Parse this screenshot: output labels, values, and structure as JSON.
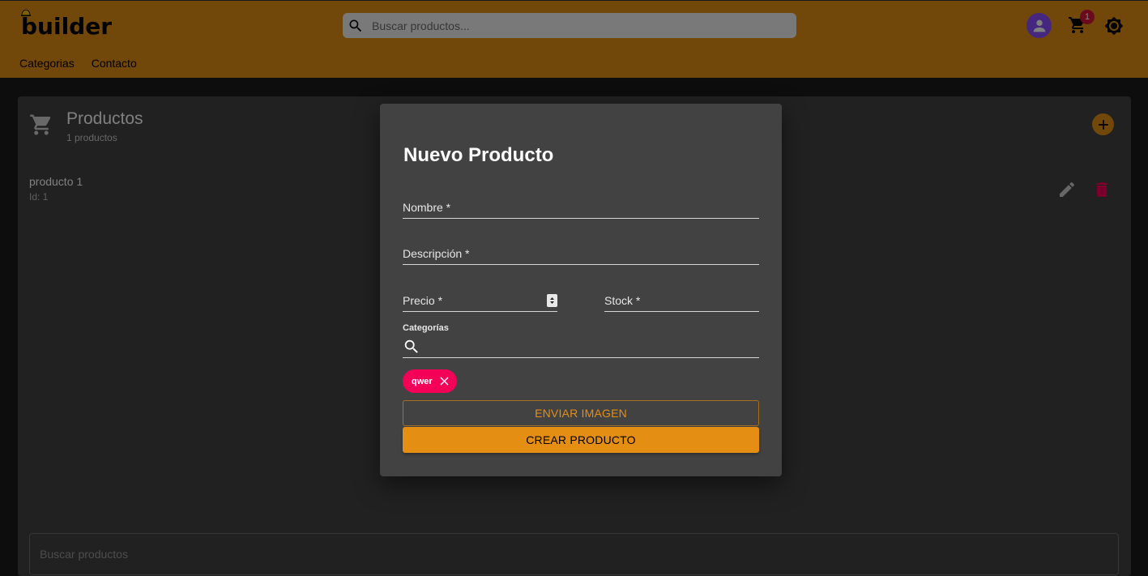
{
  "brand": {
    "name": "builder"
  },
  "header": {
    "search_placeholder": "Buscar productos...",
    "cart_count": "1",
    "nav": [
      "Categorias",
      "Contacto"
    ]
  },
  "colors": {
    "accent": "#e58e14",
    "danger": "#f50057",
    "avatar": "#8a4fff"
  },
  "panel": {
    "title": "Productos",
    "subtitle": "1 productos",
    "items": [
      {
        "name": "producto 1",
        "id_text": "Id: 1"
      }
    ],
    "bottom_search_placeholder": "Buscar productos"
  },
  "dialog": {
    "title": "Nuevo Producto",
    "fields": {
      "nombre": "Nombre *",
      "descripcion": "Descripción *",
      "precio": "Precio *",
      "stock": "Stock *"
    },
    "categories_label": "Categorías",
    "chips": [
      "qwer"
    ],
    "upload_button": "ENVIAR IMAGEN",
    "create_button": "CREAR PRODUCTO"
  }
}
